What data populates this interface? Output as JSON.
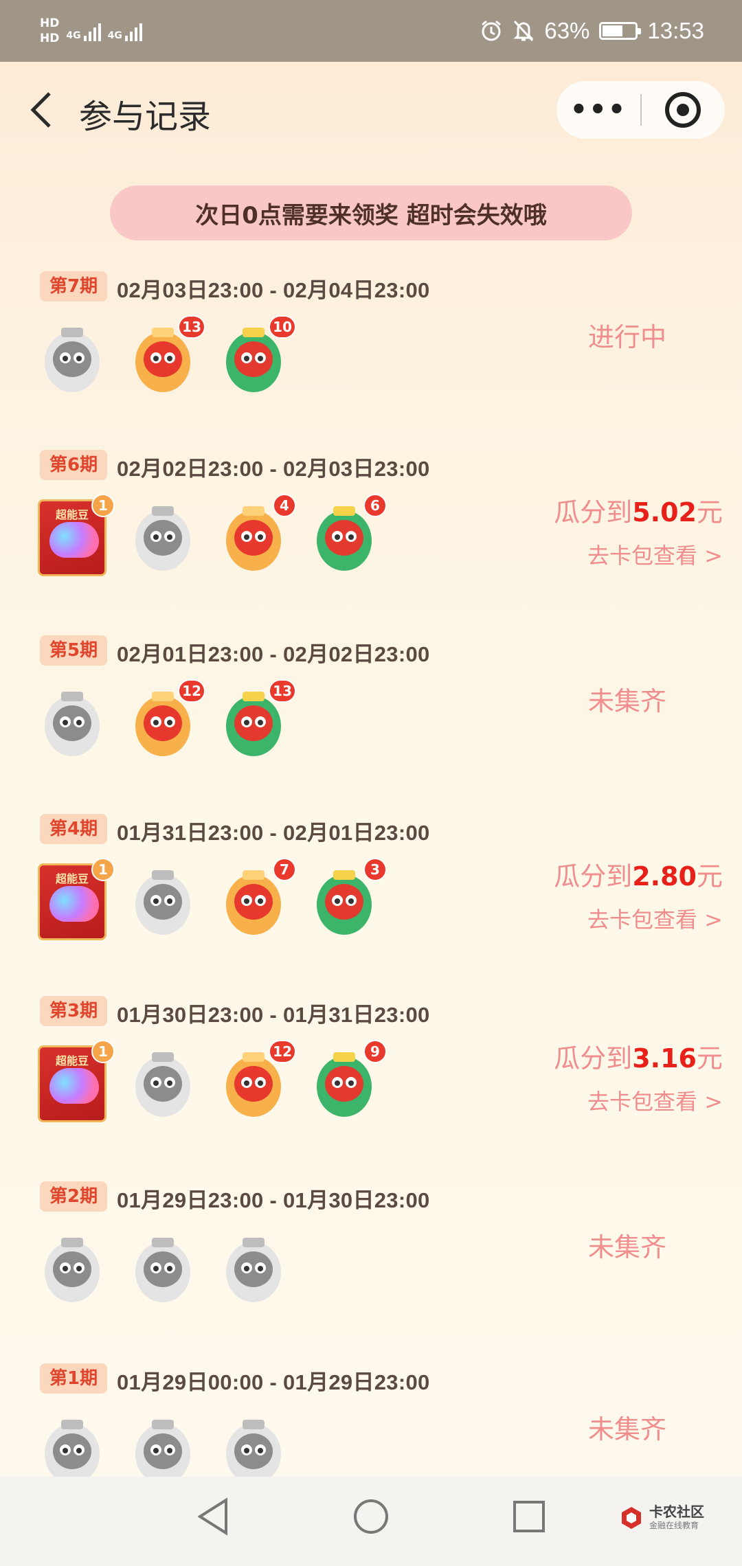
{
  "status_bar": {
    "sim1": "HD",
    "sim2": "HD",
    "net1": "4G",
    "net2": "4G",
    "battery": "63%",
    "battery_level": 0.63,
    "time": "13:53"
  },
  "header": {
    "title": "参与记录",
    "more_label": "•••"
  },
  "notice": "次日0点需要来领奖 超时会失效哦",
  "rounds": [
    {
      "tag": "第7期",
      "period": "02月03日23:00 - 02月04日23:00",
      "status": "进行中",
      "icons": [
        {
          "type": "gray"
        },
        {
          "type": "orange",
          "count": "13"
        },
        {
          "type": "green",
          "count": "10"
        }
      ]
    },
    {
      "tag": "第6期",
      "period": "02月02日23:00 - 02月03日23:00",
      "prize_prefix": "瓜分到",
      "prize_amount": "5.02",
      "prize_unit": "元",
      "link": "去卡包查看 >",
      "icons": [
        {
          "type": "card",
          "label": "超能豆",
          "count": "1"
        },
        {
          "type": "gray"
        },
        {
          "type": "orange",
          "count": "4"
        },
        {
          "type": "green",
          "count": "6"
        }
      ]
    },
    {
      "tag": "第5期",
      "period": "02月01日23:00 - 02月02日23:00",
      "status": "未集齐",
      "icons": [
        {
          "type": "gray"
        },
        {
          "type": "orange",
          "count": "12"
        },
        {
          "type": "green",
          "count": "13"
        }
      ]
    },
    {
      "tag": "第4期",
      "period": "01月31日23:00 - 02月01日23:00",
      "prize_prefix": "瓜分到",
      "prize_amount": "2.80",
      "prize_unit": "元",
      "link": "去卡包查看 >",
      "icons": [
        {
          "type": "card",
          "label": "超能豆",
          "count": "1"
        },
        {
          "type": "gray"
        },
        {
          "type": "orange",
          "count": "7"
        },
        {
          "type": "green",
          "count": "3"
        }
      ]
    },
    {
      "tag": "第3期",
      "period": "01月30日23:00 - 01月31日23:00",
      "prize_prefix": "瓜分到",
      "prize_amount": "3.16",
      "prize_unit": "元",
      "link": "去卡包查看 >",
      "icons": [
        {
          "type": "card",
          "label": "超能豆",
          "count": "1"
        },
        {
          "type": "gray"
        },
        {
          "type": "orange",
          "count": "12"
        },
        {
          "type": "green",
          "count": "9"
        }
      ]
    },
    {
      "tag": "第2期",
      "period": "01月29日23:00 - 01月30日23:00",
      "status": "未集齐",
      "icons": [
        {
          "type": "gray"
        },
        {
          "type": "gray"
        },
        {
          "type": "gray"
        }
      ]
    },
    {
      "tag": "第1期",
      "period": "01月29日00:00 - 01月29日23:00",
      "status": "未集齐",
      "icons": [
        {
          "type": "gray"
        },
        {
          "type": "gray"
        },
        {
          "type": "gray"
        }
      ]
    }
  ],
  "watermark": {
    "name": "卡农社区",
    "sub": "金融在线教育"
  },
  "colors": {
    "accent_pink": "#f08d8d",
    "prize_red": "#e8201a",
    "tag_bg": "#fad7bd",
    "tag_text": "#e0462d",
    "notice_bg": "#f9c8c6"
  }
}
